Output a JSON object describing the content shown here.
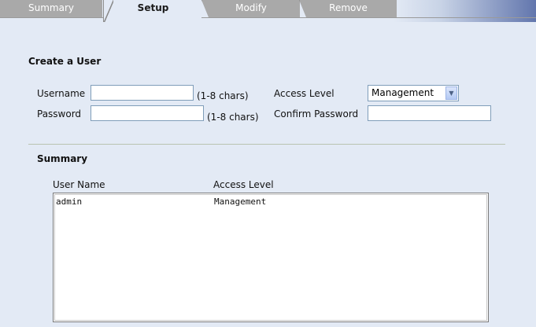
{
  "tabs": [
    {
      "label": "Summary",
      "active": false
    },
    {
      "label": "Setup",
      "active": true
    },
    {
      "label": "Modify",
      "active": false
    },
    {
      "label": "Remove",
      "active": false
    }
  ],
  "create_user": {
    "title": "Create a User",
    "username_label": "Username",
    "username_value": "",
    "username_hint": "(1-8 chars)",
    "password_label": "Password",
    "password_value": "",
    "password_hint": "(1-8 chars)",
    "access_level_label": "Access Level",
    "access_level_value": "Management",
    "confirm_password_label": "Confirm Password",
    "confirm_password_value": ""
  },
  "summary": {
    "title": "Summary",
    "columns": [
      "User Name",
      "Access Level"
    ],
    "rows": [
      {
        "user_name": "admin",
        "access_level": "Management"
      }
    ]
  },
  "colors": {
    "background": "#e3eaf5",
    "tab_inactive": "#a9a9a9",
    "tabbar_gradient_end": "#6276ad"
  }
}
